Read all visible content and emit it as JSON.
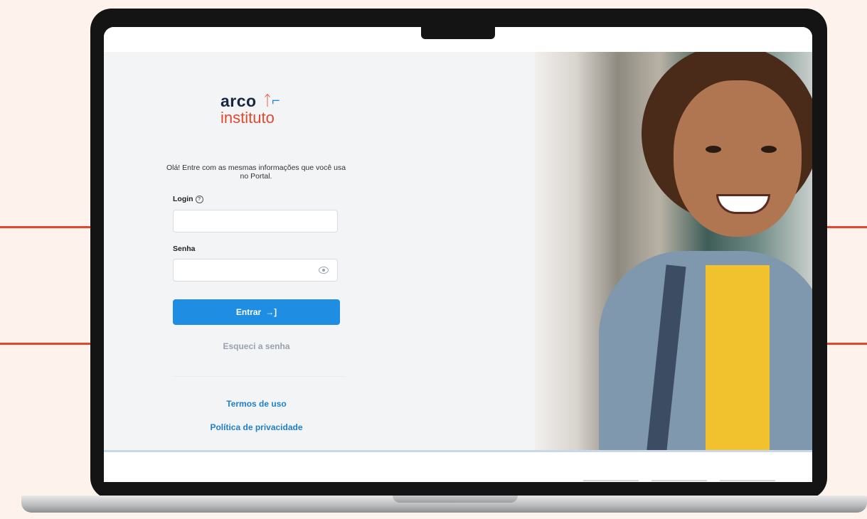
{
  "brand": {
    "name_line1": "arco",
    "name_line2": "instituto",
    "colors": {
      "orange": "#e2492c",
      "blue": "#1f8de1",
      "navy": "#1b2740"
    }
  },
  "login_form": {
    "intro_text": "Olá! Entre com as mesmas informações que você usa no Portal.",
    "login_label": "Login",
    "login_value": "",
    "password_label": "Senha",
    "password_value": "",
    "submit_label": "Entrar",
    "submit_icon": "sign-in-arrow-icon",
    "forgot_password_label": "Esqueci a senha"
  },
  "footer_links": {
    "terms": "Termos de uso",
    "privacy": "Política de privacidade"
  },
  "hero_photo": {
    "icon": "photo-of-smiling-child"
  }
}
